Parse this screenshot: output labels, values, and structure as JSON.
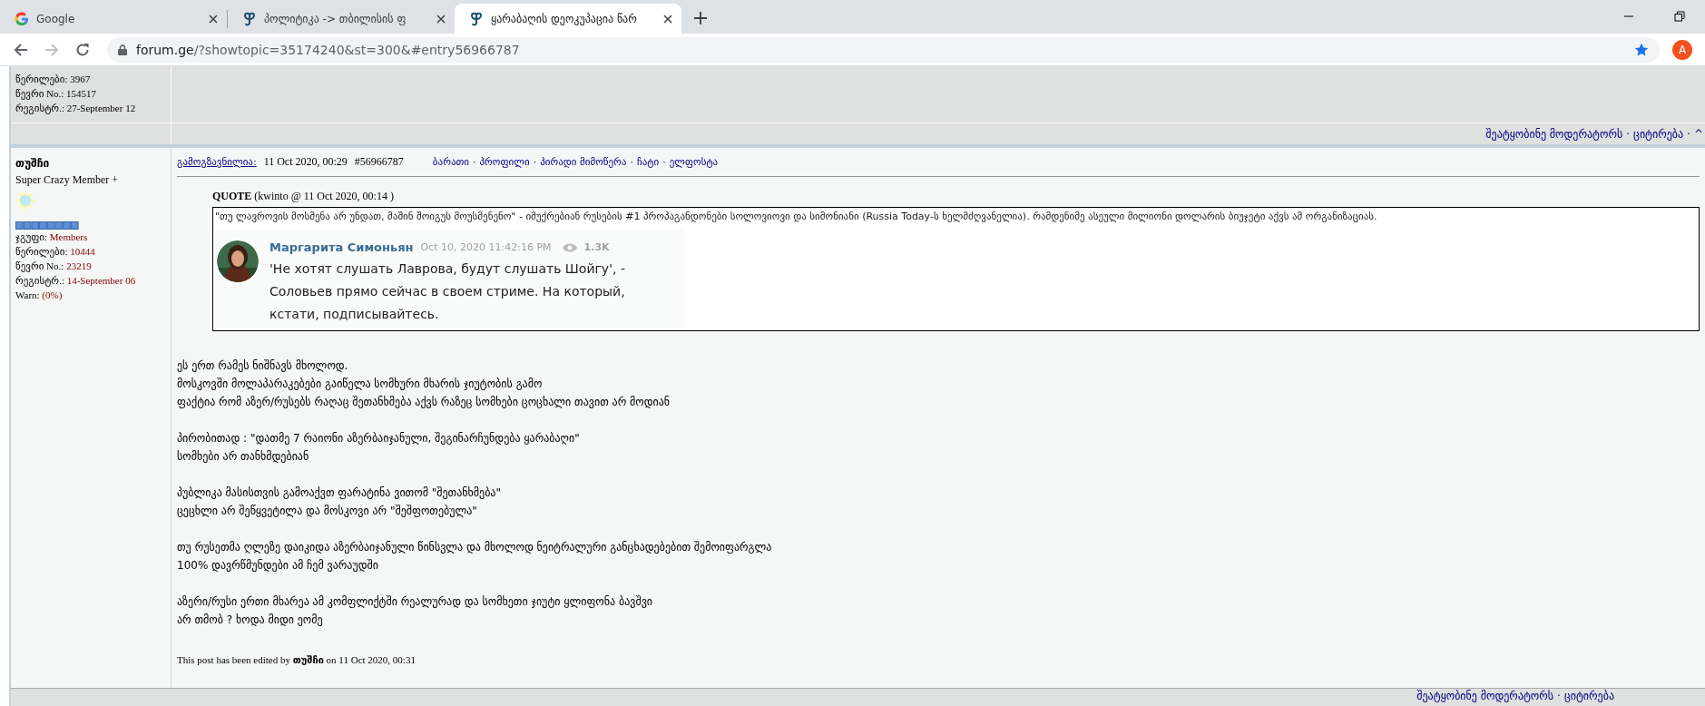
{
  "browser": {
    "tabs": [
      {
        "title": "Google",
        "kind": "google",
        "selected": false
      },
      {
        "title": "პოლიტიკა -> თბილისის ფ",
        "kind": "forum",
        "selected": false
      },
      {
        "title": "ყარაბაღის დეოკუპაცია წარ",
        "kind": "forum",
        "selected": true
      }
    ],
    "address": {
      "host": "forum.ge",
      "path": "/?showtopic=35174240&st=300&#entry56966787"
    },
    "bookmarked": true,
    "profile_initial": "A"
  },
  "previous_post": {
    "author_stats": [
      "წერილები: 3967",
      "წევრი No.: 154517",
      "რეგისტრ.: 27-September 12"
    ],
    "actions": [
      "შეატყობინე მოდერატორს",
      "ციტირება",
      "^"
    ],
    "separator": "·"
  },
  "post": {
    "author": "თუშჩი",
    "rank": "Super Crazy Member +",
    "stats": [
      {
        "label": "ჯგუფი:",
        "value": "Members"
      },
      {
        "label": "წერილები:",
        "value": "10444"
      },
      {
        "label": "წევრი No.:",
        "value": "23219"
      },
      {
        "label": "რეგისტრ.:",
        "value": "14-September 06"
      },
      {
        "label": "Warn:",
        "value": "(0%)"
      }
    ],
    "sent_label": "გამოგზავნილია:",
    "date": "11 Oct 2020, 00:29",
    "entry": "#56966787",
    "links": [
      "ბარათი",
      "პროფილი",
      "პირადი მიმოწერა",
      "ჩატი",
      "ელფოსტა"
    ],
    "link_separator": "·",
    "quote": {
      "label": "QUOTE",
      "source": "(kwinto @ 11 Oct 2020, 00:14 )",
      "text": "\"თუ ლავროვის მოსმენა არ უნდათ, მაშინ შოიგუს მოუსმენენო\" - იმუქრებიან რუსების #1 პროპაგანდონები სოლოვიოვი და სიმონიანი (Russia Today-ს ხელმძღვანელია). რამდენიმე ასეული მილიონი დოლარის ბიუჯეტი აქვს ამ ორგანიზაციას.",
      "embed": {
        "name": "Маргарита Симоньян",
        "date": "Oct 10, 2020 11:42:16 PM",
        "views": "1.3K",
        "text": "'Не хотят слушать Лаврова, будут слушать Шойгу', - Соловьев прямо сейчас в своем стриме. На который, кстати, подписывайтесь."
      }
    },
    "paragraphs": [
      [
        "ეს ერთ რამეს ნიშნავს მხოლოდ.",
        "მოსკოვში მოლაპარაკებები გაიწელა სომხური მხარის ჯიუტობის გამო",
        "ფაქტია რომ აზერ/რუსებს რაღაც შეთანხმება აქვს რაზეც სომხები ცოცხალი თავით არ მოდიან"
      ],
      [
        "პირობითად : \"დათმე 7 რაიონი აზერბაიჯანული, შეგინარჩუნდება ყარაბაღი\"",
        "სომხები არ თანხმდებიან"
      ],
      [
        "პუბლიკა მასისთვის გამოაქვთ ფარატინა ვითომ \"შეთანხმება\"",
        "ცეცხლი არ შეწყვეტილა და მოსკოვი არ \"შეშფოთებულა\""
      ],
      [
        "თუ რუსეთმა ღლეზე დაიკიდა აზერბაიჯანული წინსვლა და მხოლოდ ნეიტრალური განცხადებებით შემოიფარგლა",
        "100% დავრწმუნდები ამ ჩემ ვარაუდში"
      ],
      [
        "აზერი/რუსი ერთი მხარეა ამ კომფლიქტში რეალურად და სომხეთი ჯიუტი ყლიფონა ბავშვი",
        "არ თმობ ? ხოდა მიდი ეომე"
      ]
    ],
    "edited": "This post has been edited by **თუშჩი** on 11 Oct 2020, 00:31"
  },
  "next_post": {
    "actions": [
      "შეატყობინე მოდერატორს",
      "ციტირება"
    ],
    "separator": "·"
  }
}
